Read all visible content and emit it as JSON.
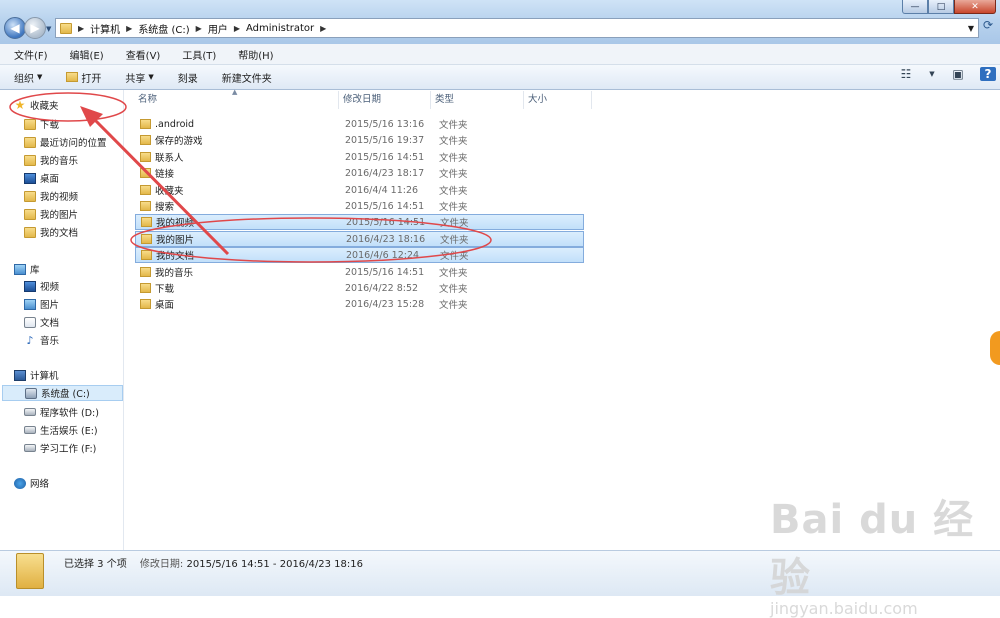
{
  "window": {
    "controls": [
      "—",
      "□",
      "✕"
    ]
  },
  "address_bar": {
    "crumbs": [
      "计算机",
      "系统盘 (C:)",
      "用户",
      "Administrator"
    ]
  },
  "menu": [
    "文件(F)",
    "编辑(E)",
    "查看(V)",
    "工具(T)",
    "帮助(H)"
  ],
  "toolbar": {
    "organize": "组织",
    "open": "打开",
    "share": "共享",
    "burn": "刻录",
    "new_folder": "新建文件夹"
  },
  "sidebar": {
    "favorites": {
      "header": "收藏夹",
      "items": [
        "下载",
        "最近访问的位置",
        "我的音乐",
        "桌面",
        "我的视频",
        "我的图片",
        "我的文档"
      ]
    },
    "libraries": {
      "header": "库",
      "items": [
        "视频",
        "图片",
        "文档",
        "音乐"
      ]
    },
    "computer": {
      "header": "计算机",
      "items": [
        "系统盘 (C:)",
        "程序软件 (D:)",
        "生活娱乐 (E:)",
        "学习工作 (F:)"
      ]
    },
    "network": {
      "header": "网络"
    }
  },
  "columns": [
    "名称",
    "修改日期",
    "类型",
    "大小"
  ],
  "files": [
    {
      "name": ".android",
      "date": "2015/5/16 13:16",
      "type": "文件夹",
      "selected": false
    },
    {
      "name": "保存的游戏",
      "date": "2015/5/16 19:37",
      "type": "文件夹",
      "selected": false
    },
    {
      "name": "联系人",
      "date": "2015/5/16 14:51",
      "type": "文件夹",
      "selected": false
    },
    {
      "name": "链接",
      "date": "2016/4/23 18:17",
      "type": "文件夹",
      "selected": false
    },
    {
      "name": "收藏夹",
      "date": "2016/4/4 11:26",
      "type": "文件夹",
      "selected": false
    },
    {
      "name": "搜索",
      "date": "2015/5/16 14:51",
      "type": "文件夹",
      "selected": false
    },
    {
      "name": "我的视频",
      "date": "2015/5/16 14:51",
      "type": "文件夹",
      "selected": true
    },
    {
      "name": "我的图片",
      "date": "2016/4/23 18:16",
      "type": "文件夹",
      "selected": true
    },
    {
      "name": "我的文档",
      "date": "2016/4/6 12:24",
      "type": "文件夹",
      "selected": true
    },
    {
      "name": "我的音乐",
      "date": "2015/5/16 14:51",
      "type": "文件夹",
      "selected": false
    },
    {
      "name": "下载",
      "date": "2016/4/22 8:52",
      "type": "文件夹",
      "selected": false
    },
    {
      "name": "桌面",
      "date": "2016/4/23 15:28",
      "type": "文件夹",
      "selected": false
    }
  ],
  "status": {
    "selection": "已选择 3 个项",
    "modified_label": "修改日期:",
    "modified_range": "2015/5/16 14:51 - 2016/4/23 18:16"
  },
  "watermark": {
    "main": "Bai du 经验",
    "sub": "jingyan.baidu.com"
  },
  "colors": {
    "annotation_red": "#e0484a",
    "selection_fill": "#cde6fb",
    "accent_orange": "#f29a1f"
  }
}
